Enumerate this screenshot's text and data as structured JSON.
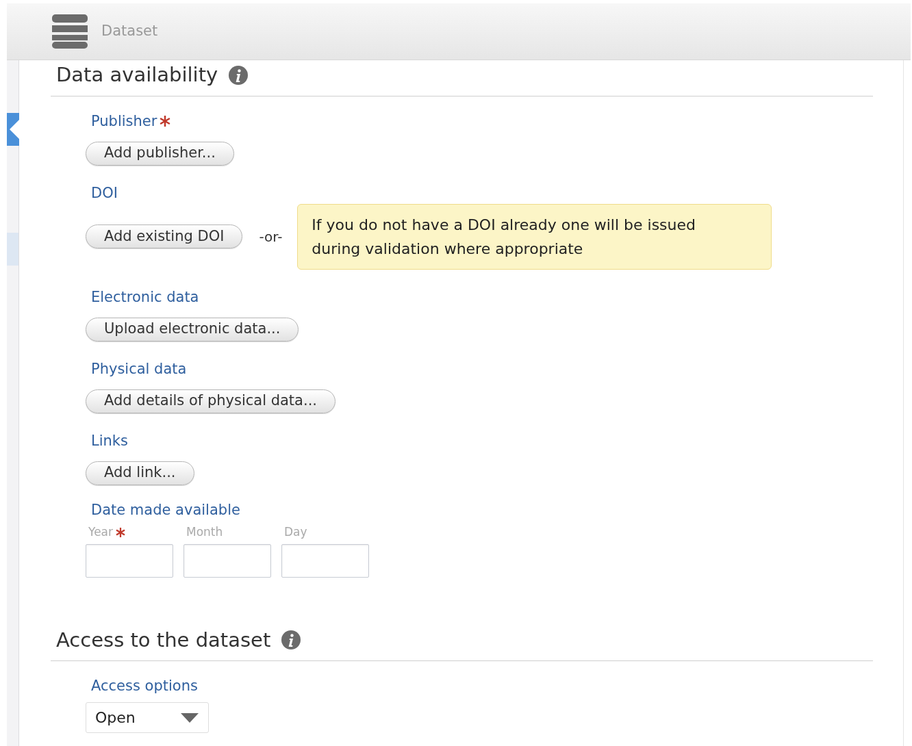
{
  "header": {
    "title": "Dataset"
  },
  "sections": [
    {
      "title": "Data availability",
      "fields": [
        {
          "kind": "button",
          "label": "Publisher",
          "required": true,
          "button": "Add publisher..."
        },
        {
          "kind": "button",
          "label": "DOI",
          "required": false,
          "button": "Add existing DOI",
          "separator": "-or-",
          "note": "If you do not have a DOI already one will be issued during validation where appropriate"
        },
        {
          "kind": "button",
          "label": "Electronic data",
          "required": false,
          "button": "Upload electronic data..."
        },
        {
          "kind": "button",
          "label": "Physical data",
          "required": false,
          "button": "Add details of physical data..."
        },
        {
          "kind": "button",
          "label": "Links",
          "required": false,
          "button": "Add link..."
        },
        {
          "kind": "date",
          "label": "Date made available",
          "required": false,
          "parts": [
            {
              "label": "Year",
              "required": true
            },
            {
              "label": "Month",
              "required": false
            },
            {
              "label": "Day",
              "required": false
            }
          ]
        }
      ]
    },
    {
      "title": "Access to the dataset",
      "fields": [
        {
          "kind": "select",
          "label": "Access options",
          "required": false,
          "value": "Open"
        }
      ]
    }
  ]
}
